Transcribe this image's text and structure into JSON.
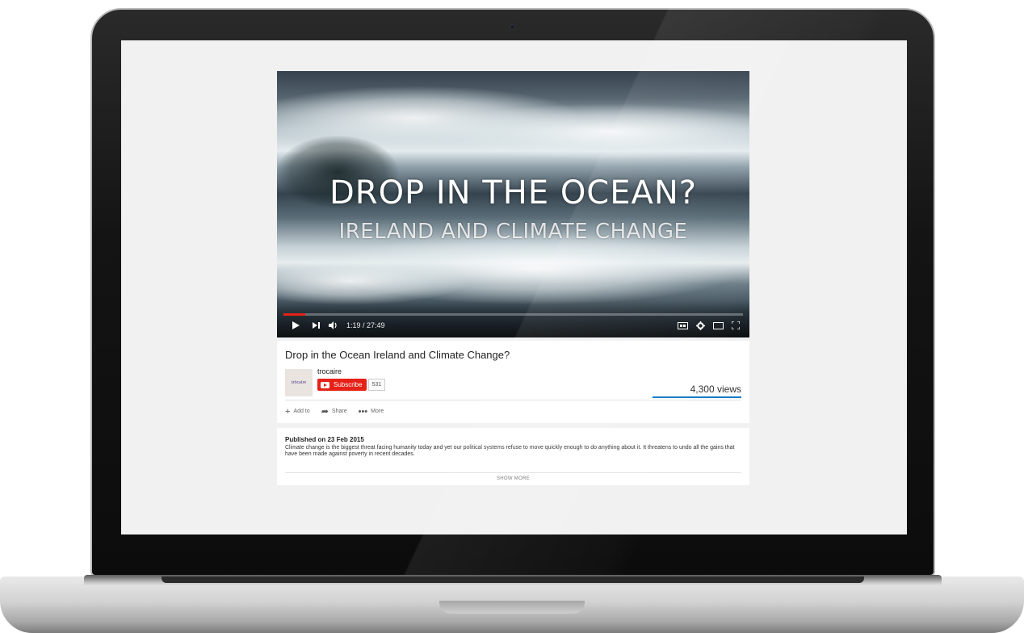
{
  "player": {
    "overlay_title": "DROP IN THE OCEAN?",
    "overlay_subtitle": "IRELAND  AND CLIMATE CHANGE",
    "time": "1:19 / 27:49",
    "progress_fraction": 0.047,
    "accent": "#e62117"
  },
  "video": {
    "title": "Drop in the Ocean Ireland and Climate Change?",
    "channel": "trocaire",
    "channel_thumb_text": "trōcaire",
    "subscribe_label": "Subscribe",
    "subscriber_count": "531",
    "views": "4,300 views",
    "actions": [
      {
        "icon": "plus-icon",
        "label": "Add to"
      },
      {
        "icon": "share-icon",
        "label": "Share"
      },
      {
        "icon": "more-icon",
        "label": "More"
      }
    ]
  },
  "description": {
    "published": "Published on 23 Feb 2015",
    "text": "Climate change is the biggest threat facing humanity today and yet our political systems refuse to move quickly enough to do anything about it. It threatens to undo all the gains that have been made against poverty in recent decades.",
    "show_more": "SHOW MORE"
  },
  "colors": {
    "screen_bg": "#f1f1f1",
    "subscribe_red": "#e62117",
    "sentiment_blue": "#167ac6"
  }
}
